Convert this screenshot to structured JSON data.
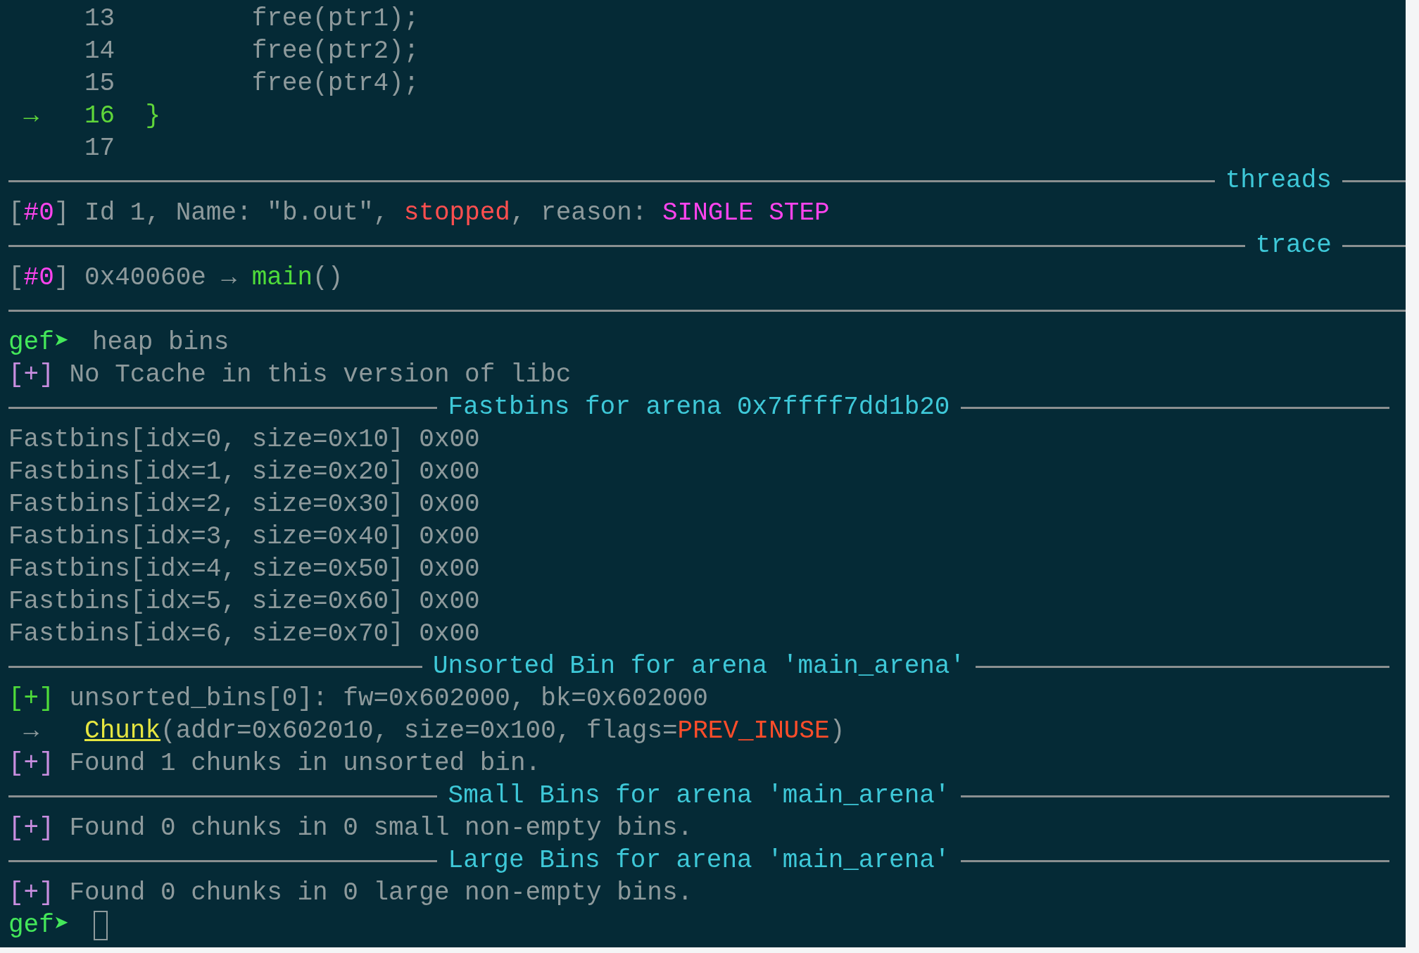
{
  "terminal": {
    "lines": [
      {
        "kind": "source",
        "current": false,
        "number": "13",
        "code": "       free(ptr1);"
      },
      {
        "kind": "source",
        "current": false,
        "number": "14",
        "code": "       free(ptr2);"
      },
      {
        "kind": "source",
        "current": false,
        "number": "15",
        "code": "       free(ptr4);"
      },
      {
        "kind": "source",
        "current": true,
        "marker": "→",
        "number": "16",
        "code": "}"
      },
      {
        "kind": "source",
        "current": false,
        "number": "17"
      },
      {
        "kind": "pane_header",
        "title": "threads"
      },
      {
        "kind": "text",
        "segments": [
          {
            "kind": "plain",
            "text": "["
          },
          {
            "kind": "magenta",
            "text": "#0"
          },
          {
            "kind": "plain",
            "text": "] Id 1, Name: \"b.out\", "
          },
          {
            "kind": "red",
            "text": "stopped"
          },
          {
            "kind": "plain",
            "text": ", reason: "
          },
          {
            "kind": "magenta",
            "text": "SINGLE STEP"
          }
        ]
      },
      {
        "kind": "pane_header",
        "title": "trace"
      },
      {
        "kind": "text",
        "segments": [
          {
            "kind": "plain",
            "text": "["
          },
          {
            "kind": "magenta",
            "text": "#0"
          },
          {
            "kind": "plain",
            "text": "] 0x40060e → "
          },
          {
            "kind": "green",
            "text": "main"
          },
          {
            "kind": "plain",
            "text": "()"
          }
        ]
      },
      {
        "kind": "divider"
      },
      {
        "kind": "prompt",
        "prompt": "gef➤",
        "command": "heap bins"
      },
      {
        "kind": "text",
        "segments": [
          {
            "kind": "lilac",
            "text": "[+]"
          },
          {
            "kind": "plain",
            "text": " No Tcache in this version of libc"
          }
        ]
      },
      {
        "kind": "section_header",
        "title": "Fastbins for arena 0x7ffff7dd1b20"
      },
      {
        "kind": "text",
        "segments": [
          {
            "kind": "plain",
            "text": "Fastbins[idx=0, size=0x10] 0x00"
          }
        ]
      },
      {
        "kind": "text",
        "segments": [
          {
            "kind": "plain",
            "text": "Fastbins[idx=1, size=0x20] 0x00"
          }
        ]
      },
      {
        "kind": "text",
        "segments": [
          {
            "kind": "plain",
            "text": "Fastbins[idx=2, size=0x30] 0x00"
          }
        ]
      },
      {
        "kind": "text",
        "segments": [
          {
            "kind": "plain",
            "text": "Fastbins[idx=3, size=0x40] 0x00"
          }
        ]
      },
      {
        "kind": "text",
        "segments": [
          {
            "kind": "plain",
            "text": "Fastbins[idx=4, size=0x50] 0x00"
          }
        ]
      },
      {
        "kind": "text",
        "segments": [
          {
            "kind": "plain",
            "text": "Fastbins[idx=5, size=0x60] 0x00"
          }
        ]
      },
      {
        "kind": "text",
        "segments": [
          {
            "kind": "plain",
            "text": "Fastbins[idx=6, size=0x70] 0x00"
          }
        ]
      },
      {
        "kind": "section_header",
        "title": "Unsorted Bin for arena 'main_arena'"
      },
      {
        "kind": "text",
        "segments": [
          {
            "kind": "green",
            "text": "[+]"
          },
          {
            "kind": "plain",
            "text": " unsorted_bins[0]: fw=0x602000, bk=0x602000"
          }
        ]
      },
      {
        "kind": "text",
        "segments": [
          {
            "kind": "plain",
            "text": " →   "
          },
          {
            "kind": "link",
            "text": "Chunk"
          },
          {
            "kind": "plain",
            "text": "(addr=0x602010, size=0x100, flags="
          },
          {
            "kind": "orange",
            "text": "PREV_INUSE"
          },
          {
            "kind": "plain",
            "text": ")"
          }
        ]
      },
      {
        "kind": "text",
        "segments": [
          {
            "kind": "lilac",
            "text": "[+]"
          },
          {
            "kind": "plain",
            "text": " Found 1 chunks in unsorted bin."
          }
        ]
      },
      {
        "kind": "section_header",
        "title": "Small Bins for arena 'main_arena'"
      },
      {
        "kind": "text",
        "segments": [
          {
            "kind": "lilac",
            "text": "[+]"
          },
          {
            "kind": "plain",
            "text": " Found 0 chunks in 0 small non-empty bins."
          }
        ]
      },
      {
        "kind": "section_header",
        "title": "Large Bins for arena 'main_arena'"
      },
      {
        "kind": "text",
        "segments": [
          {
            "kind": "lilac",
            "text": "[+]"
          },
          {
            "kind": "plain",
            "text": " Found 0 chunks in 0 large non-empty bins."
          }
        ]
      },
      {
        "kind": "input_prompt",
        "prompt": "gef➤"
      }
    ]
  }
}
